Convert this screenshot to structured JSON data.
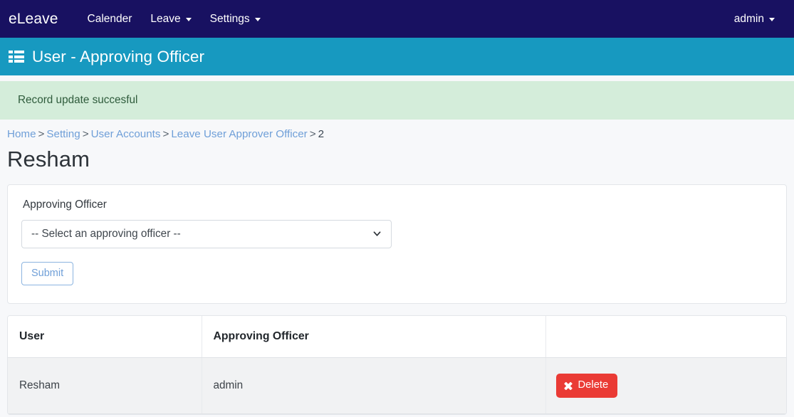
{
  "navbar": {
    "brand": "eLeave",
    "items": [
      {
        "label": "Calender",
        "has_caret": false
      },
      {
        "label": "Leave",
        "has_caret": true
      },
      {
        "label": "Settings",
        "has_caret": true
      }
    ],
    "user": {
      "label": "admin",
      "has_caret": true
    },
    "background_color": "#181161"
  },
  "page_header": {
    "icon": "th-list-icon",
    "title": "User - Approving Officer",
    "background_color": "#1799c0"
  },
  "alert": {
    "message": "Record update succesful",
    "type": "success",
    "background_color": "#d4edda",
    "text_color": "#2e5b3b"
  },
  "breadcrumb": {
    "items": [
      {
        "label": "Home",
        "link": true
      },
      {
        "label": "Setting",
        "link": true
      },
      {
        "label": "User Accounts",
        "link": true
      },
      {
        "label": "Leave User Approver Officer",
        "link": true
      },
      {
        "label": "2",
        "link": false
      }
    ],
    "separator": ">",
    "link_color": "#6f9fd8"
  },
  "page_title": "Resham",
  "form": {
    "label": "Approving Officer",
    "select": {
      "selected": "-- Select an approving officer --",
      "options": [
        "-- Select an approving officer --"
      ],
      "chevron_icon": "chevron-down-icon"
    },
    "submit_label": "Submit"
  },
  "table": {
    "columns": [
      "User",
      "Approving Officer",
      ""
    ],
    "rows": [
      {
        "user": "Resham",
        "approving_officer": "admin",
        "action_label": "Delete",
        "action_icon": "times-icon",
        "action_color": "#ea3b35"
      }
    ]
  }
}
